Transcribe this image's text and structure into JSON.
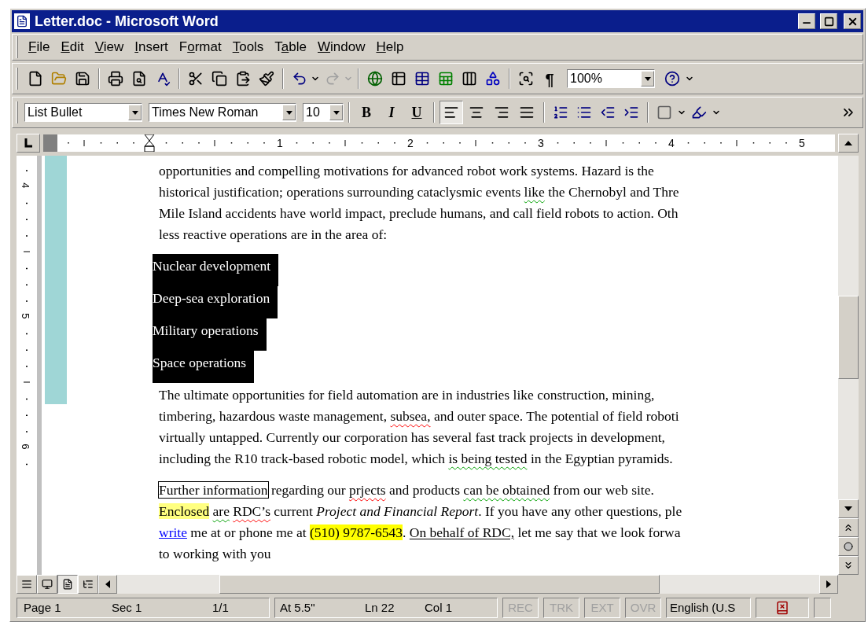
{
  "window": {
    "title": "Letter.doc - Microsoft Word"
  },
  "menu": [
    {
      "mnemonic": "F",
      "rest": "ile"
    },
    {
      "mnemonic": "E",
      "rest": "dit"
    },
    {
      "mnemonic": "V",
      "rest": "iew"
    },
    {
      "mnemonic": "I",
      "rest": "nsert"
    },
    {
      "before": "F",
      "mnemonic": "o",
      "rest": "rmat"
    },
    {
      "mnemonic": "T",
      "rest": "ools"
    },
    {
      "before": "T",
      "mnemonic": "a",
      "rest": "ble"
    },
    {
      "mnemonic": "W",
      "rest": "indow"
    },
    {
      "mnemonic": "H",
      "rest": "elp"
    }
  ],
  "standard_toolbar": {
    "undo": {
      "disabled": false
    },
    "redo": {
      "disabled": true
    },
    "show_hide": "¶",
    "zoom": "100%"
  },
  "formatting_toolbar": {
    "style": "List Bullet",
    "font": "Times New Roman",
    "size": "10",
    "bold": "B",
    "italic": "I",
    "underline": "U",
    "alignment": [
      {
        "selected": true
      },
      {
        "selected": false
      },
      {
        "selected": false
      },
      {
        "selected": false
      }
    ]
  },
  "horizontal_ruler": {
    "numbers": [
      "1",
      "2",
      "3",
      "4",
      "5"
    ]
  },
  "vertical_ruler": {
    "numbers": [
      "4",
      "5",
      "6"
    ]
  },
  "document": {
    "blocks": [
      {
        "kind": "paragraph",
        "lines": [
          [
            {
              "kind": "text",
              "text": "opportunities and compelling motivations for advanced robot work systems. Hazard is the"
            }
          ],
          [
            {
              "kind": "text",
              "text": "historical justification; operations surrounding cataclysmic events "
            },
            {
              "kind": "grammar",
              "text": "like"
            },
            {
              "kind": "text",
              "text": " the Chernobyl and Thre"
            }
          ],
          [
            {
              "kind": "text",
              "text": "Mile Island accidents have world impact, preclude humans, and call field robots to action. Oth"
            }
          ],
          [
            {
              "kind": "text",
              "text": "less reactive operations are in the area of:"
            }
          ]
        ]
      },
      {
        "kind": "list",
        "items": [
          {
            "text": "Nuclear development",
            "selected": true
          },
          {
            "text": "Deep-sea exploration",
            "selected": true
          },
          {
            "text": "Military operations",
            "selected": true
          },
          {
            "text": "Space operations",
            "selected": true
          }
        ]
      },
      {
        "kind": "paragraph",
        "lines": [
          [
            {
              "kind": "text",
              "text": "The ultimate opportunities for field automation are in industries like construction, mining,"
            }
          ],
          [
            {
              "kind": "text",
              "text": "timbering, hazardous waste management, "
            },
            {
              "kind": "spelling",
              "text": "subsea,"
            },
            {
              "kind": "text",
              "text": " and outer space. The potential of field roboti"
            }
          ],
          [
            {
              "kind": "text",
              "text": "virtually untapped. Currently our corporation has several fast track projects in development,"
            }
          ],
          [
            {
              "kind": "text",
              "text": "including the R10 track-based robotic model, which "
            },
            {
              "kind": "grammar",
              "text": "is being tested"
            },
            {
              "kind": "text",
              "text": " in the Egyptian pyramids."
            }
          ]
        ]
      },
      {
        "kind": "paragraph",
        "lines": [
          [
            {
              "kind": "boxed",
              "text": "Further information"
            },
            {
              "kind": "text",
              "text": " regarding our "
            },
            {
              "kind": "spelling",
              "text": "prjects"
            },
            {
              "kind": "text",
              "text": " and products "
            },
            {
              "kind": "grammar",
              "text": "can be obtained"
            },
            {
              "kind": "text",
              "text": " from our web site."
            }
          ],
          [
            {
              "kind": "highlight",
              "text": "Enclosed",
              "color": "#ffff80"
            },
            {
              "kind": "grammar",
              "text": "are",
              "space_before": true
            },
            {
              "kind": "spelling",
              "text": "RDC’s",
              "space_before": true
            },
            {
              "kind": "text",
              "text": " current "
            },
            {
              "kind": "italic",
              "text": "Project and Financial Report"
            },
            {
              "kind": "text",
              "text": ". If you have any other questions, ple"
            }
          ],
          [
            {
              "kind": "link",
              "text": "write"
            },
            {
              "kind": "text",
              "text": " me at or phone me at "
            },
            {
              "kind": "highlight",
              "text": "(510) 9787-6543",
              "color": "#ffff00"
            },
            {
              "kind": "text",
              "text": ". "
            },
            {
              "kind": "underline",
              "text": "On behalf of RDC,"
            },
            {
              "kind": "text",
              "text": " let me say that we look forwa"
            }
          ],
          [
            {
              "kind": "text",
              "text": "to working with you"
            }
          ]
        ]
      }
    ]
  },
  "views": [
    {
      "selected": false
    },
    {
      "selected": false
    },
    {
      "selected": true
    },
    {
      "selected": false
    }
  ],
  "status_bar": {
    "page": "Page 1",
    "section": "Sec 1",
    "pages": "1/1",
    "at": "At 5.5\"",
    "line": "Ln 22",
    "column": "Col 1",
    "indicators": [
      {
        "label": "REC",
        "active": false
      },
      {
        "label": "TRK",
        "active": false
      },
      {
        "label": "EXT",
        "active": false
      },
      {
        "label": "OVR",
        "active": false
      }
    ],
    "language": "English (U.S"
  }
}
